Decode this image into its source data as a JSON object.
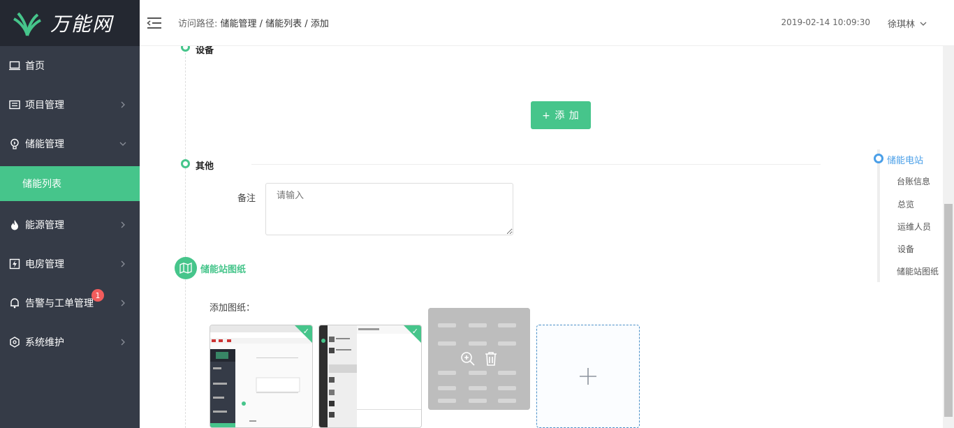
{
  "app": {
    "logo_text": "万能网"
  },
  "sidebar": {
    "items": [
      {
        "label": "首页",
        "icon": "monitor-icon"
      },
      {
        "label": "项目管理",
        "icon": "list-icon"
      },
      {
        "label": "储能管理",
        "icon": "bulb-icon"
      },
      {
        "label": "储能列表"
      },
      {
        "label": "能源管理",
        "icon": "fire-icon"
      },
      {
        "label": "电房管理",
        "icon": "bolt-icon"
      },
      {
        "label": "告警与工单管理",
        "icon": "bell-icon",
        "badge": "1"
      },
      {
        "label": "系统维护",
        "icon": "gear-icon"
      }
    ]
  },
  "header": {
    "breadcrumb_prefix": "访问路径:",
    "breadcrumb": "储能管理 / 储能列表 / 添加",
    "datetime": "2019-02-14 10:09:30",
    "user": "徐琪林"
  },
  "main": {
    "section_equipment": "设备",
    "add_button": "+ 添 加",
    "section_other": "其他",
    "remark_label": "备注",
    "remark_placeholder": "请输入",
    "drawings_title": "储能站图纸",
    "add_drawings_label": "添加图纸："
  },
  "anchor_nav": {
    "items": [
      "储能电站",
      "台账信息",
      "总览",
      "运维人员",
      "设备",
      "储能站图纸"
    ]
  },
  "colors": {
    "accent": "#46c58b",
    "sidebar": "#353b47",
    "anchor_active": "#4a9fe8"
  }
}
